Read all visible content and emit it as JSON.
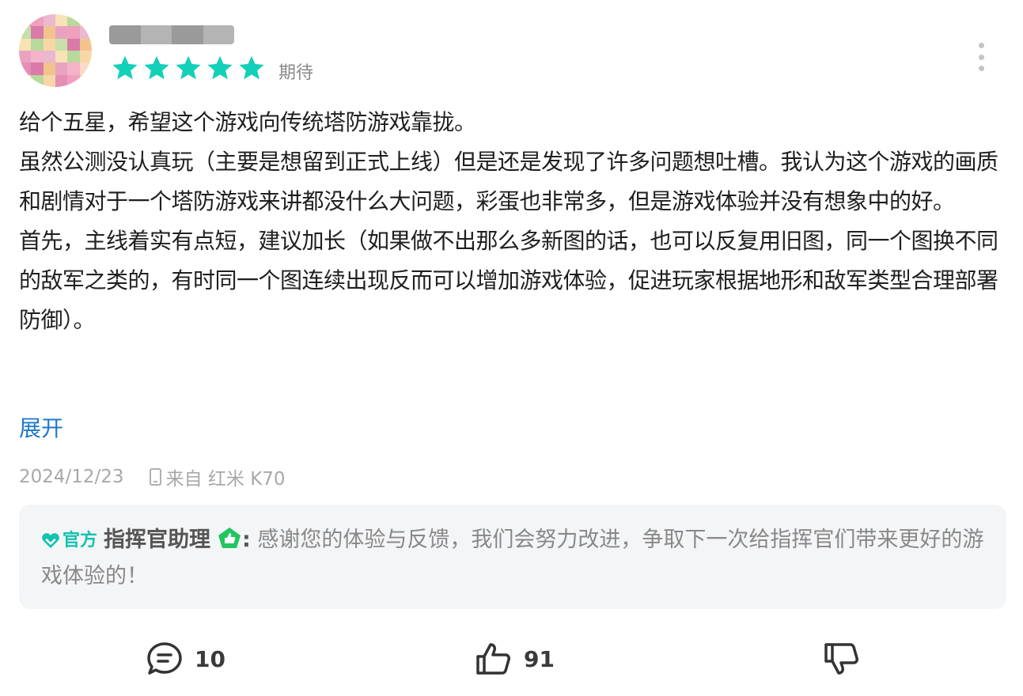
{
  "review": {
    "rating_label": "期待",
    "stars": 5,
    "paragraphs": [
      "给个五星，希望这个游戏向传统塔防游戏靠拢。",
      "虽然公测没认真玩（主要是想留到正式上线）但是还是发现了许多问题想吐槽。我认为这个游戏的画质和剧情对于一个塔防游戏来讲都没什么大问题，彩蛋也非常多，但是游戏体验并没有想象中的好。",
      "首先，主线着实有点短，建议加长（如果做不出那么多新图的话，也可以反复用旧图，同一个图换不同的敌军之类的，有时同一个图连续出现反而可以增加游戏体验，促进玩家根据地形和敌军类型合理部署防御）。"
    ],
    "expand_label": "展开",
    "date": "2024/12/23",
    "device": "来自 红米 K70"
  },
  "reply": {
    "badge_label": "官方",
    "author": "指挥官助理",
    "colon": ":",
    "text": "感谢您的体验与反馈，我们会努力改进，争取下一次给指挥官们带来更好的游戏体验的！"
  },
  "actions": {
    "comment_count": "10",
    "like_count": "91"
  },
  "colors": {
    "star": "#13d0b8",
    "accent_link": "#1f78c8",
    "official": "#13c2b0",
    "dev_badge": "#22c55e"
  },
  "icons": [
    "star-icon",
    "more-icon",
    "phone-icon",
    "official-heart-icon",
    "developer-badge-icon",
    "comment-icon",
    "thumbs-up-icon",
    "thumbs-down-icon"
  ]
}
